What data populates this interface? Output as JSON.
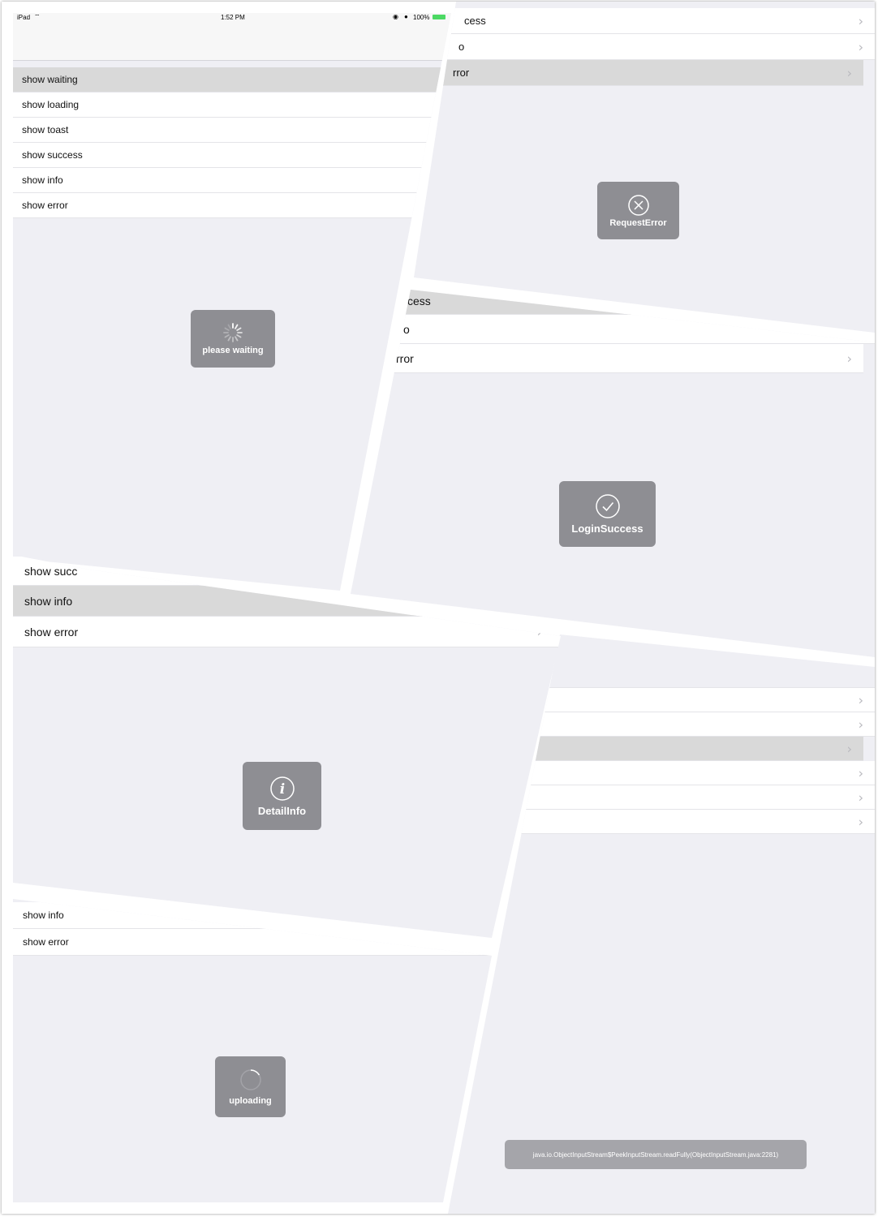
{
  "status_bar": {
    "carrier": "iPad",
    "time": "1:52 PM",
    "battery": "100%"
  },
  "menu_items": [
    "show waiting",
    "show loading",
    "show toast",
    "show success",
    "show info",
    "show error"
  ],
  "partial_labels": {
    "success_end": "cess",
    "info_end": "o",
    "error_end": "rror",
    "success_cut": "show succ"
  },
  "hud": {
    "waiting": "please waiting",
    "request_error": "RequestError",
    "login_success": "LoginSuccess",
    "detail_info": "DetailInfo",
    "uploading": "uploading"
  },
  "toast_text": "java.io.ObjectInputStream$PeekInputStream.readFully(ObjectInputStream.java:2281)",
  "chevron": "›",
  "colors": {
    "hud": "#8e8e93",
    "background": "#efeff4",
    "selected_row": "#d9d9d9",
    "battery": "#4cd964"
  }
}
